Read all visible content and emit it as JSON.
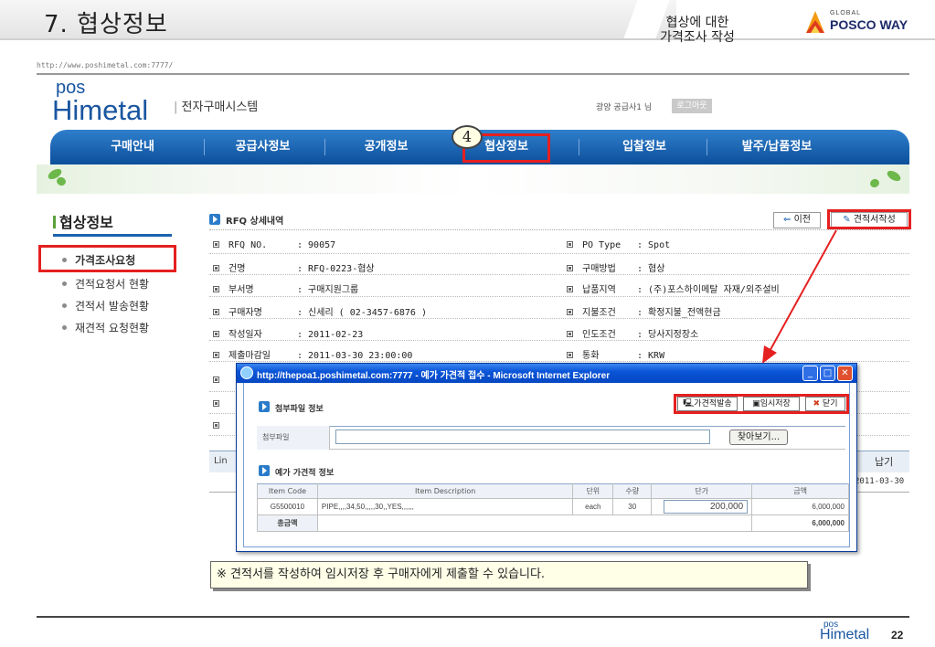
{
  "slide": {
    "title": "7. 협상정보",
    "subtitle_line1": "협상에 대한",
    "subtitle_line2": "가격조사 작성",
    "brand_global": "GLOBAL",
    "brand_name": "POSCO WAY",
    "page_number": "22"
  },
  "url_fragment": "http://www.poshimetal.com:7777/",
  "site": {
    "logo_top": "pos",
    "logo_bottom": "Himetal",
    "system_name": "전자구매시스템",
    "user_greeting": "광양 공급사1 님",
    "logout_label": "로그아웃"
  },
  "nav": {
    "items": [
      "구매안내",
      "공급사정보",
      "공개정보",
      "협상정보",
      "입찰정보",
      "발주/납품정보"
    ],
    "step_number": "4"
  },
  "sidebar": {
    "title": "협상정보",
    "items": [
      "가격조사요청",
      "견적요청서 현황",
      "견적서 발송현황",
      "재견적 요청현황"
    ]
  },
  "rfq": {
    "section_title": "RFQ 상세내역",
    "prev_label": "이전",
    "write_label": "견적서작성",
    "left_fields": [
      {
        "label": "RFQ NO.",
        "value": ": 90057"
      },
      {
        "label": "건명",
        "value": ": RFQ-0223-협상"
      },
      {
        "label": "부서명",
        "value": ": 구매지원그룹"
      },
      {
        "label": "구매자명",
        "value": ": 신세리 ( 02-3457-6876 )"
      },
      {
        "label": "작성일자",
        "value": ": 2011-02-23"
      },
      {
        "label": "제출마감일",
        "value": ": 2011-03-30 23:00:00"
      }
    ],
    "right_fields": [
      {
        "label": "PO Type",
        "value": ": Spot"
      },
      {
        "label": "구매방법",
        "value": ": 협상"
      },
      {
        "label": "납품지역",
        "value": ": (주)포스하이메탈 자재/외주설비"
      },
      {
        "label": "지불조건",
        "value": ": 확정지불_전액현금"
      },
      {
        "label": "인도조건",
        "value": ": 당사지정장소"
      },
      {
        "label": "통화",
        "value": ": KRW"
      }
    ],
    "line_left_label": "Lin",
    "delivery_header": "납기",
    "delivery_date": "2011-03-30"
  },
  "popup": {
    "title": "http://thepoa1.poshimetal.com:7777 - 예가 가견적 접수 - Microsoft Internet Explorer",
    "attach_section": "첨부파일 정보",
    "attach_label": "첨부파일",
    "attach_value": "",
    "browse_label": "찾아보기...",
    "buttons": {
      "send": "가견적발송",
      "save": "임시저장",
      "close": "닫기"
    },
    "estimate_section": "예가 가견적 정보",
    "columns": [
      "Item Code",
      "Item Description",
      "단위",
      "수량",
      "단가",
      "금액"
    ],
    "rows": [
      {
        "code": "G5500010",
        "desc": "PIPE,,,,34,50,,,,,30,,YES,,,,,,",
        "unit": "each",
        "qty": "30",
        "price": "200,000",
        "amount": "6,000,000"
      }
    ],
    "total_label": "총금액",
    "total_value": "6,000,000"
  },
  "callout": "※ 견적서를 작성하여 임시저장 후 구매자에게 제출할 수 있습니다.",
  "colors": {
    "accent_red": "#e52020",
    "nav_blue": "#0c4f9b",
    "brand_blue": "#1a56a0"
  }
}
